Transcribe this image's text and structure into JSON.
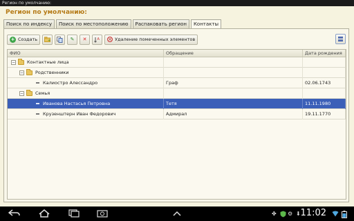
{
  "window": {
    "title": "Регион по умолчанию:"
  },
  "form": {
    "title": "Регион по умолчанию:"
  },
  "tabs": [
    {
      "label": "Поиск по индексу",
      "active": false
    },
    {
      "label": "Поиск по местоположению",
      "active": false
    },
    {
      "label": "Распаковать регион",
      "active": false
    },
    {
      "label": "Контакты",
      "active": true
    }
  ],
  "toolbar": {
    "create_label": "Создать",
    "delete_marked_label": "Удаление помеченных элементов"
  },
  "table": {
    "columns": [
      "ФИО",
      "Обращение",
      "Дата рождения"
    ],
    "rows": [
      {
        "level": 0,
        "type": "group",
        "name": "Контактные лица",
        "title": "",
        "birth": "",
        "selected": false
      },
      {
        "level": 1,
        "type": "group",
        "name": "Родственники",
        "title": "",
        "birth": "",
        "selected": false
      },
      {
        "level": 2,
        "type": "item",
        "name": "Калиостро Алессандро",
        "title": "Граф",
        "birth": "02.06.1743",
        "selected": false
      },
      {
        "level": 1,
        "type": "group",
        "name": "Семья",
        "title": "",
        "birth": "",
        "selected": false
      },
      {
        "level": 2,
        "type": "item",
        "name": "Иванова Настасья Петровна",
        "title": "Тетя",
        "birth": "11.11.1980",
        "selected": true
      },
      {
        "level": 2,
        "type": "item",
        "name": "Крузенштерн Иван Федорович",
        "title": "Адмирал",
        "birth": "19.11.1770",
        "selected": false
      }
    ]
  },
  "system_bar": {
    "time": "11:02",
    "icons": [
      "back-icon",
      "home-icon",
      "recent-apps-icon",
      "screenshot-icon",
      "up-arrow-icon",
      "usb-icon",
      "shield-icon",
      "download-icon",
      "wifi-icon",
      "battery-icon"
    ]
  },
  "colors": {
    "selection": "#3b5fb8",
    "title": "#b57a16",
    "background": "#f6f3df"
  }
}
